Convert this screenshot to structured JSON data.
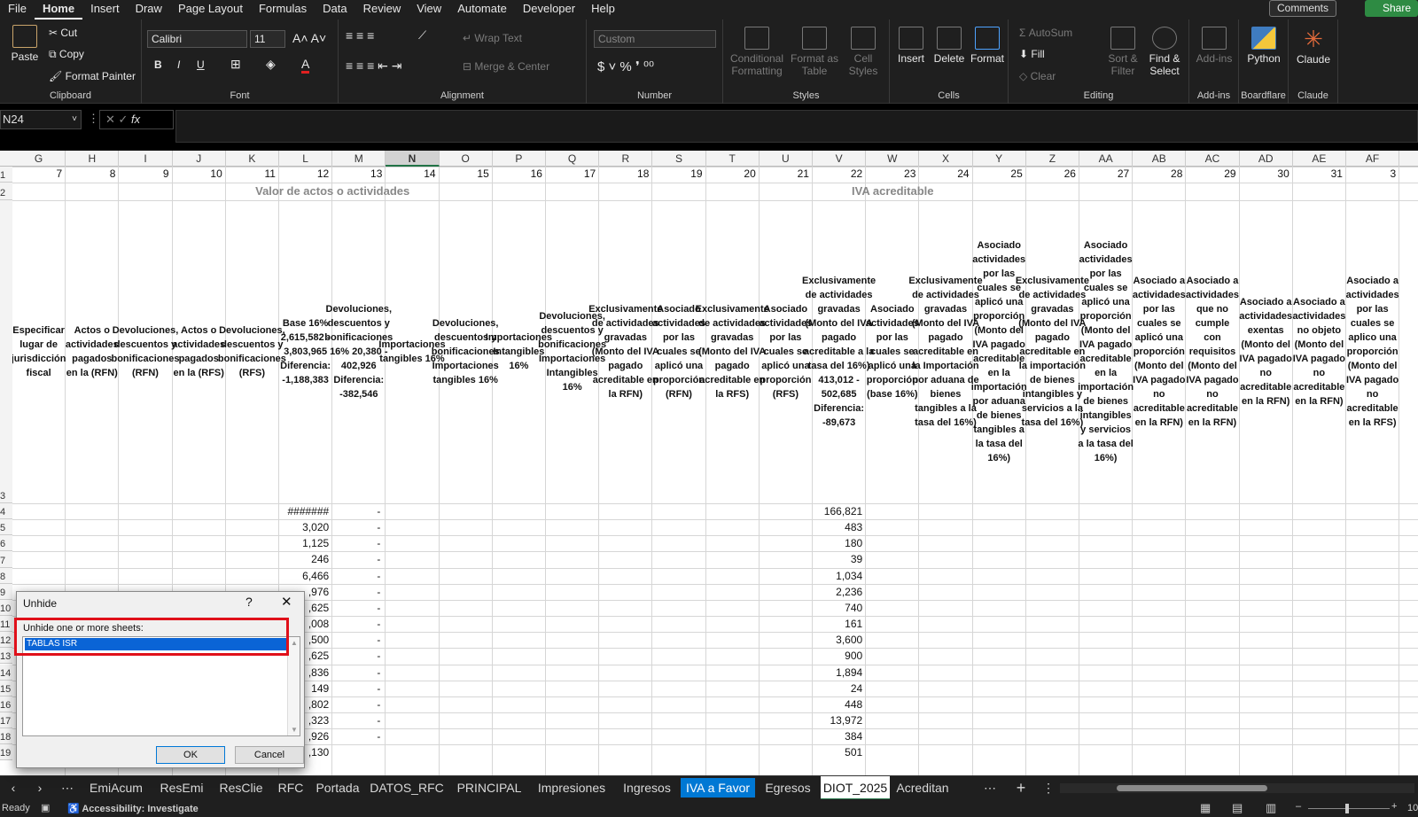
{
  "menu": [
    "File",
    "Home",
    "Insert",
    "Draw",
    "Page Layout",
    "Formulas",
    "Data",
    "Review",
    "View",
    "Automate",
    "Developer",
    "Help"
  ],
  "menu_active": "Home",
  "comments_label": "Comments",
  "share_label": "Share",
  "ribbon": {
    "clipboard": {
      "label": "Clipboard",
      "paste": "Paste",
      "cut": "Cut",
      "copy": "Copy",
      "format_painter": "Format Painter"
    },
    "font": {
      "label": "Font",
      "name": "Calibri",
      "size": "11",
      "bold": "B",
      "italic": "I",
      "underline": "U"
    },
    "alignment": {
      "label": "Alignment",
      "wrap": "Wrap Text",
      "merge": "Merge & Center"
    },
    "number": {
      "label": "Number",
      "format": "Custom"
    },
    "styles": {
      "label": "Styles",
      "conditional": "Conditional Formatting",
      "format_table": "Format as Table",
      "cell_styles": "Cell Styles"
    },
    "cells": {
      "label": "Cells",
      "insert": "Insert",
      "delete": "Delete",
      "format": "Format"
    },
    "editing": {
      "label": "Editing",
      "autosum": "AutoSum",
      "fill": "Fill",
      "clear": "Clear",
      "sort": "Sort & Filter",
      "find": "Find & Select"
    },
    "addins": {
      "label": "Add-ins",
      "addins": "Add-ins"
    },
    "boardflare": {
      "label": "Boardflare",
      "python": "Python"
    },
    "claude": {
      "label": "Claude",
      "claude": "Claude"
    }
  },
  "name_box": "N24",
  "fx": "fx",
  "columns": [
    {
      "l": "G",
      "n": "7",
      "h": "Especificar lugar de jurisdicción fiscal"
    },
    {
      "l": "H",
      "n": "8",
      "h": "Actos o actividades pagados en la (RFN)"
    },
    {
      "l": "I",
      "n": "9",
      "h": "Devoluciones, descuentos y bonificaciones (RFN)"
    },
    {
      "l": "J",
      "n": "10",
      "h": "Actos o actividades pagados en la (RFS)"
    },
    {
      "l": "K",
      "n": "11",
      "h": "Devoluciones, descuentos y bonificaciones (RFS)"
    },
    {
      "l": "L",
      "n": "12",
      "h": "Base 16% 2,615,582 - 3,803,965 Diferencia: -1,188,383"
    },
    {
      "l": "M",
      "n": "13",
      "h": "Devoluciones, descuentos y bonificaciones 16% 20,380 - 402,926 Diferencia: -382,546"
    },
    {
      "l": "N",
      "n": "14",
      "h": "Importaciones tangibles 16%"
    },
    {
      "l": "O",
      "n": "15",
      "h": "Devoluciones, descuentos y bonificaciones Importaciones tangibles 16%"
    },
    {
      "l": "P",
      "n": "16",
      "h": "Importaciones Intangibles 16%"
    },
    {
      "l": "Q",
      "n": "17",
      "h": "Devoluciones, descuentos y bonificaciones Importaciones Intangibles 16%"
    },
    {
      "l": "R",
      "n": "18",
      "h": "Exclusivamente de actividades gravadas (Monto del IVA pagado acreditable en la RFN)"
    },
    {
      "l": "S",
      "n": "19",
      "h": "Asociado actividades por las cuales se aplicó una proporción (RFN)"
    },
    {
      "l": "T",
      "n": "20",
      "h": "Exclusivamente de actividades gravadas (Monto del IVA pagado acreditable en la RFS)"
    },
    {
      "l": "U",
      "n": "21",
      "h": "Asociado actividades por las cuales se aplicó una proporción (RFS)"
    },
    {
      "l": "V",
      "n": "22",
      "h": "Exclusivamente de actividades gravadas (Monto del IVA pagado acreditable a la tasa del 16%) 413,012 - 502,685 Diferencia: -89,673"
    },
    {
      "l": "W",
      "n": "23",
      "h": "Asociado actividades por las cuales se aplicó una proporción (base 16%)"
    },
    {
      "l": "X",
      "n": "24",
      "h": "Exclusivamente de actividades gravadas (Monto del IVA pagado acreditable en la Importación por aduana de bienes tangibles a la tasa del 16%)"
    },
    {
      "l": "Y",
      "n": "25",
      "h": "Asociado actividades por las cuales se aplicó una proporción (Monto del IVA pagado acreditable en la importación por aduana de bienes tangibles a la tasa del 16%)"
    },
    {
      "l": "Z",
      "n": "26",
      "h": "Exclusivamente de actividades gravadas (Monto del IVA pagado acreditable en la importación de bienes intangibles y servicios a la tasa del 16%)"
    },
    {
      "l": "AA",
      "n": "27",
      "h": "Asociado actividades por las cuales se aplicó una proporción (Monto del IVA pagado acreditable en la importación de bienes intangibles y servicios a la tasa del 16%)"
    },
    {
      "l": "AB",
      "n": "28",
      "h": "Asociado a actividades por las cuales se aplicó una proporción (Monto del IVA pagado no acreditable en la RFN)"
    },
    {
      "l": "AC",
      "n": "29",
      "h": "Asociado a actividades que no cumple con requisitos (Monto del IVA pagado no acreditable en la RFN)"
    },
    {
      "l": "AD",
      "n": "30",
      "h": "Asociado a actividades exentas (Monto del IVA pagado no acreditable en la RFN)"
    },
    {
      "l": "AE",
      "n": "31",
      "h": "Asociado a actividades no objeto (Monto del IVA pagado no acreditable en la RFN)"
    },
    {
      "l": "AF",
      "n": "3",
      "h": "Asociado a actividades por las cuales se aplico una proporción (Monto del IVA pagado no acreditable en la RFS)"
    }
  ],
  "band1": "Valor de actos o actividades",
  "band2": "IVA  acreditable",
  "row_numbers": [
    "1",
    "2",
    "3",
    "4",
    "5",
    "6",
    "7",
    "8",
    "9",
    "10",
    "11",
    "12",
    "13",
    "14",
    "15",
    "16",
    "17",
    "18",
    "19"
  ],
  "col_L_values": [
    "#######",
    "3,020",
    "1,125",
    "246",
    "6,466",
    ",976",
    ",625",
    ",008",
    ",500",
    ",625",
    ",836",
    "149",
    ",802",
    ",323",
    ",926",
    ",130"
  ],
  "col_M_values": [
    "-",
    "-",
    "-",
    "-",
    "-",
    "-",
    "-",
    "-",
    "-",
    "-",
    "-",
    "-",
    "-",
    "-",
    "-"
  ],
  "col_V_values": [
    "166,821",
    "483",
    "180",
    "39",
    "1,034",
    "2,236",
    "740",
    "161",
    "3,600",
    "900",
    "1,894",
    "24",
    "448",
    "13,972",
    "384",
    "501"
  ],
  "dialog": {
    "title": "Unhide",
    "help": "?",
    "close": "✕",
    "label": "Unhide one or more sheets:",
    "item": "TABLAS ISR",
    "ok": "OK",
    "cancel": "Cancel"
  },
  "tabs": [
    "EmiAcum",
    "ResEmi",
    "ResClie",
    "RFC",
    "Portada",
    "DATOS_RFC",
    "PRINCIPAL",
    "Impresiones",
    "Ingresos",
    "IVA a Favor",
    "Egresos",
    "DIOT_2025",
    "Acreditan"
  ],
  "tab_colored": "IVA a Favor",
  "tab_active": "DIOT_2025",
  "status": {
    "ready": "Ready",
    "accessibility": "Accessibility: Investigate",
    "zoom": "10"
  }
}
